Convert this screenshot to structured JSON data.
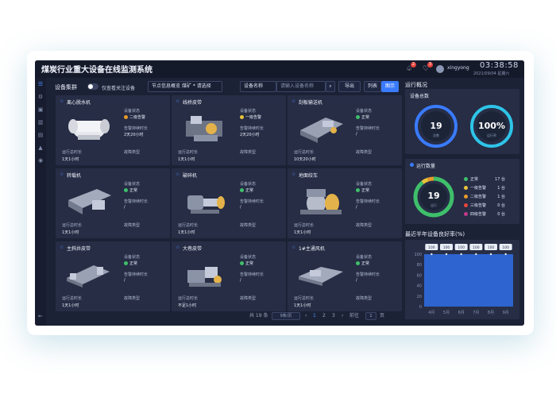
{
  "app": {
    "title": "煤炭行业重大设备在线监测系统"
  },
  "header": {
    "notif_count_1": "2",
    "notif_count_2": "3",
    "username": "xingyong",
    "time": "03:38:58",
    "date": "2021/09/04 星期六"
  },
  "sidebar": {
    "items": [
      "layers-icon",
      "settings-icon",
      "calendar-icon",
      "chart-icon",
      "report-icon",
      "warning-icon",
      "location-icon"
    ],
    "collapse": "collapse-icon"
  },
  "toolbar": {
    "label": "设备集群",
    "toggle_label": "仅查看关注设备",
    "node_filter": "节点信息概览  煤矿 * 请选择",
    "field_select": "设备名称",
    "search_placeholder": "请输入设备名称",
    "export": "导出",
    "view_list": "列表",
    "view_grid": "图示"
  },
  "card_labels": {
    "status": "设备状态",
    "alarm_duration": "告警持续时长",
    "run_time": "运行总时长",
    "fault_type": "故障类型"
  },
  "devices": [
    {
      "name": "离心脱水机",
      "status": "二级告警",
      "status_color": "#e79a2a",
      "alarm_time": "2天20小时",
      "run_time": "1天1小时",
      "fault": ""
    },
    {
      "name": "线桥皮带",
      "status": "一级告警",
      "status_color": "#e8c23a",
      "alarm_time": "2天20小时",
      "run_time": "1天1小时",
      "fault": ""
    },
    {
      "name": "刮板输送机",
      "status": "正常",
      "status_color": "#3fbf6a",
      "alarm_time": "/",
      "run_time": "10天20小时",
      "fault": ""
    },
    {
      "name": "转载机",
      "status": "正常",
      "status_color": "#3fbf6a",
      "alarm_time": "/",
      "run_time": "1天1小时",
      "fault": ""
    },
    {
      "name": "破碎机",
      "status": "正常",
      "status_color": "#3fbf6a",
      "alarm_time": "/",
      "run_time": "1天1小时",
      "fault": ""
    },
    {
      "name": "地面绞车",
      "status": "正常",
      "status_color": "#3fbf6a",
      "alarm_time": "/",
      "run_time": "1天1小时",
      "fault": ""
    },
    {
      "name": "主斜井皮带",
      "status": "正常",
      "status_color": "#3fbf6a",
      "alarm_time": "/",
      "run_time": "1天1小时",
      "fault": ""
    },
    {
      "name": "大巷皮带",
      "status": "正常",
      "status_color": "#3fbf6a",
      "alarm_time": "/",
      "run_time": "不足1小时",
      "fault": ""
    },
    {
      "name": "1#主通风机",
      "status": "正常",
      "status_color": "#3fbf6a",
      "alarm_time": "/",
      "run_time": "1天1小时",
      "fault": ""
    }
  ],
  "pager": {
    "total": "共 19 条",
    "page_size": "9条/页",
    "pages": [
      "1",
      "2",
      "3"
    ],
    "current": "1",
    "goto_label": "前往",
    "goto_value": "1",
    "page_suffix": "页"
  },
  "overview": {
    "title": "运行概况",
    "total_title": "设备总数",
    "total": "19",
    "total_sub": "总数",
    "rate": "100%",
    "rate_sub": "运行率",
    "count_title": "运行数量",
    "count_total": "19",
    "count_sub": "运行",
    "legend": [
      {
        "label": "正常",
        "value": "17 台",
        "color": "#3fbf6a"
      },
      {
        "label": "一级告警",
        "value": "1 台",
        "color": "#e8c23a"
      },
      {
        "label": "二级告警",
        "value": "1 台",
        "color": "#e79a2a"
      },
      {
        "label": "三级告警",
        "value": "0 台",
        "color": "#e8443c"
      },
      {
        "label": "四级告警",
        "value": "0 台",
        "color": "#c03a8a"
      }
    ]
  },
  "chart_data": {
    "type": "area",
    "title": "最近半年设备良好率(%)",
    "categories": [
      "4月",
      "5月",
      "6月",
      "7月",
      "8月",
      "9月"
    ],
    "values": [
      100,
      100,
      100,
      100,
      100,
      100
    ],
    "y_ticks": [
      "100",
      "80",
      "60",
      "40",
      "20",
      "0"
    ],
    "ylim": [
      0,
      100
    ],
    "grid": true,
    "color": "#2f6ee8"
  }
}
